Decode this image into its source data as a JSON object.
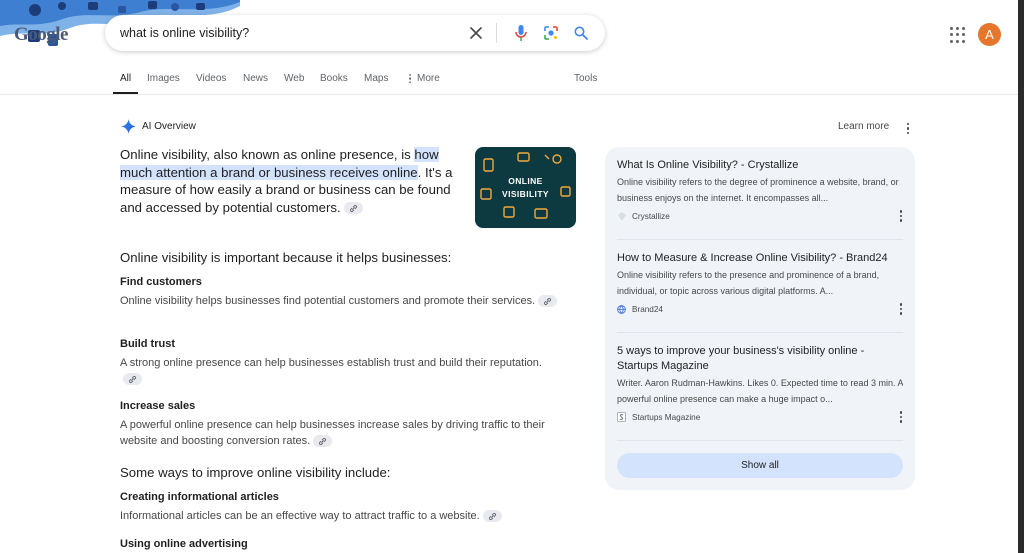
{
  "header": {
    "logo_text": "Google",
    "search": {
      "value": "what is online visibility?"
    },
    "avatar_letter": "A"
  },
  "tabs": [
    {
      "label": "All",
      "active": true
    },
    {
      "label": "Images"
    },
    {
      "label": "Videos"
    },
    {
      "label": "News"
    },
    {
      "label": "Web"
    },
    {
      "label": "Books"
    },
    {
      "label": "Maps"
    },
    {
      "label": "More"
    },
    {
      "label": "Tools"
    }
  ],
  "ai_overview": {
    "label": "AI Overview",
    "learn_more": "Learn more",
    "intro_before": "Online visibility, also known as online presence, is ",
    "intro_highlight": "how much attention a brand or business receives online",
    "intro_after": ". It's a measure of how easily a brand or business can be found and accessed by potential customers.",
    "thumbnail_text": "ONLINE VISIBILITY",
    "section1_heading": "Online visibility is important because it helps businesses:",
    "points": [
      {
        "title": "Find customers",
        "text": "Online visibility helps businesses find potential customers and promote their services."
      },
      {
        "title": "Build trust",
        "text": "A strong online presence can help businesses establish trust and build their reputation."
      },
      {
        "title": "Increase sales",
        "text": "A powerful online presence can help businesses increase sales by driving traffic to their website and boosting conversion rates."
      }
    ],
    "section2_heading": "Some ways to improve online visibility include:",
    "ways": [
      {
        "title": "Creating informational articles",
        "text": "Informational articles can be an effective way to attract traffic to a website."
      },
      {
        "title": "Using online advertising",
        "text": ""
      }
    ]
  },
  "sources": {
    "items": [
      {
        "title": "What Is Online Visibility? - Crystallize",
        "snippet": "Online visibility refers to the degree of prominence a website, brand, or business enjoys on the internet. It encompasses all...",
        "site": "Crystallize"
      },
      {
        "title": "How to Measure & Increase Online Visibility? - Brand24",
        "snippet": "Online visibility refers to the presence and prominence of a brand, individual, or topic across various digital platforms. A...",
        "site": "Brand24"
      },
      {
        "title": "5 ways to improve your business's visibility online - Startups Magazine",
        "snippet": "Writer. Aaron Rudman-Hawkins. Likes 0. Expected time to read 3 min. A powerful online presence can make a huge impact o...",
        "site": "Startups Magazine"
      }
    ],
    "show_all": "Show all"
  },
  "colors": {
    "accent_blue": "#1a73e8",
    "highlight": "#d3e3fd",
    "panel_bg": "#f0f4f9",
    "avatar": "#e4762d",
    "thumb_bg": "#0c3a40",
    "thumb_icon": "#f2a93b"
  }
}
